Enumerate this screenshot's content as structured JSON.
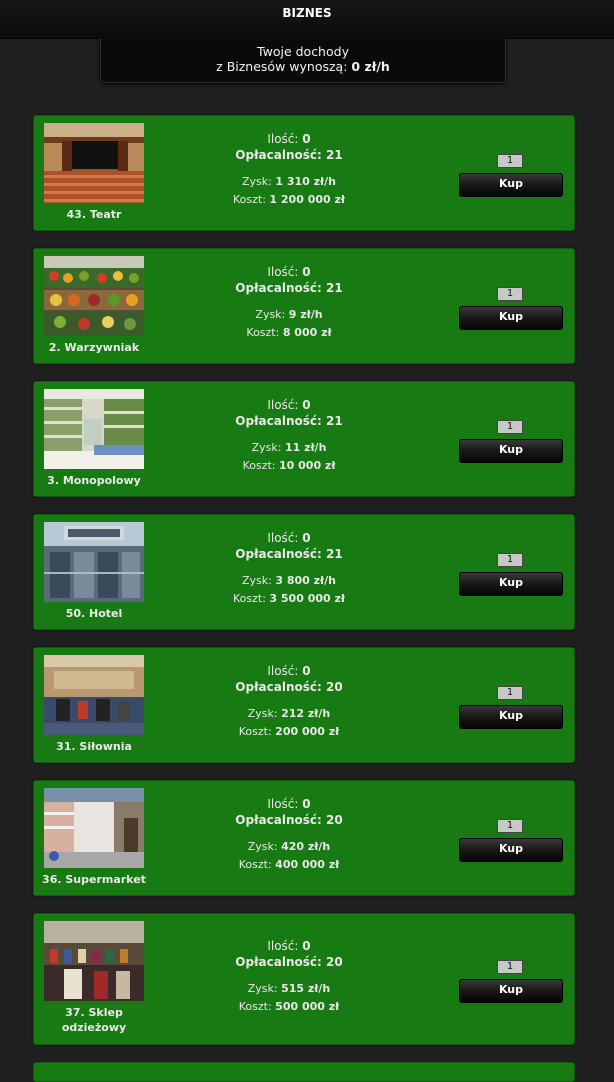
{
  "header": {
    "title": "BIZNES"
  },
  "income": {
    "line1": "Twoje dochody",
    "line2_prefix": "z Biznesów wynoszą:",
    "value": "0 zł/h"
  },
  "labels": {
    "qty": "Ilość:",
    "profitability": "Opłacalność:",
    "gain": "Zysk:",
    "cost": "Koszt:",
    "buy": "Kup"
  },
  "businesses": [
    {
      "name": "43. Teatr",
      "qty": "0",
      "profitability": "21",
      "gain": "1 310 zł/h",
      "cost": "1 200 000 zł",
      "amount": "1",
      "image": "theatre-photo"
    },
    {
      "name": "2. Warzywniak",
      "qty": "0",
      "profitability": "21",
      "gain": "9 zł/h",
      "cost": "8 000 zł",
      "amount": "1",
      "image": "vegetable-stand-photo"
    },
    {
      "name": "3. Monopolowy",
      "qty": "0",
      "profitability": "21",
      "gain": "11 zł/h",
      "cost": "10 000 zł",
      "amount": "1",
      "image": "liquor-store-photo"
    },
    {
      "name": "50. Hotel",
      "qty": "0",
      "profitability": "21",
      "gain": "3 800 zł/h",
      "cost": "3 500 000 zł",
      "amount": "1",
      "image": "hotel-photo"
    },
    {
      "name": "31. Siłownia",
      "qty": "0",
      "profitability": "20",
      "gain": "212 zł/h",
      "cost": "200 000 zł",
      "amount": "1",
      "image": "gym-photo"
    },
    {
      "name": "36. Supermarket",
      "qty": "0",
      "profitability": "20",
      "gain": "420 zł/h",
      "cost": "400 000 zł",
      "amount": "1",
      "image": "supermarket-photo"
    },
    {
      "name": "37. Sklep odzieżowy",
      "qty": "0",
      "profitability": "20",
      "gain": "515 zł/h",
      "cost": "500 000 zł",
      "amount": "1",
      "image": "clothing-store-photo"
    }
  ],
  "colors": {
    "card_bg": "#177a12",
    "page_bg": "#1f1f1f",
    "button_bg": "#111111"
  }
}
